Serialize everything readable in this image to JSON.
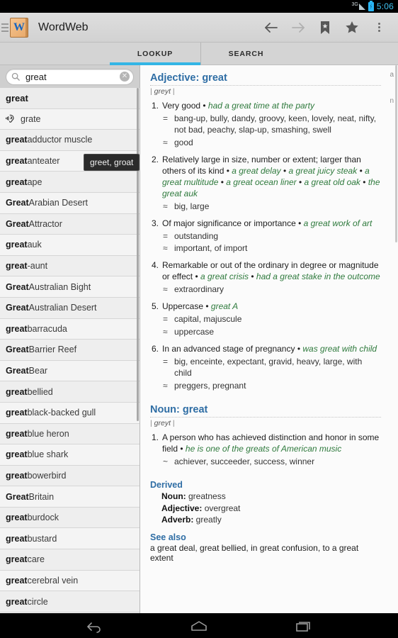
{
  "statusbar": {
    "network": "3G",
    "time": "5:06"
  },
  "actionbar": {
    "app_title": "WordWeb",
    "logo_letter": "W",
    "buttons": [
      {
        "name": "back",
        "label": "Back"
      },
      {
        "name": "forward",
        "label": "Forward"
      },
      {
        "name": "bookmark",
        "label": "Bookmarks"
      },
      {
        "name": "favourite",
        "label": "Favourite"
      },
      {
        "name": "overflow",
        "label": "More options"
      }
    ]
  },
  "tabs": [
    {
      "label": "LOOKUP",
      "active": true
    },
    {
      "label": "SEARCH",
      "active": false
    }
  ],
  "search": {
    "value": "great",
    "placeholder": "Search",
    "clear_label": "✕"
  },
  "tooltip": {
    "text": "greet, groat"
  },
  "wordlist": [
    {
      "bold": "great",
      "rest": "",
      "icon": null
    },
    {
      "bold": "",
      "rest": "grate",
      "icon": "sounds-like-icon"
    },
    {
      "bold": "great",
      "rest": " adductor muscle",
      "icon": null
    },
    {
      "bold": "great",
      "rest": " anteater",
      "icon": null
    },
    {
      "bold": "great",
      "rest": " ape",
      "icon": null
    },
    {
      "bold": "Great",
      "rest": " Arabian Desert",
      "icon": null
    },
    {
      "bold": "Great",
      "rest": " Attractor",
      "icon": null
    },
    {
      "bold": "great",
      "rest": " auk",
      "icon": null
    },
    {
      "bold": "great",
      "rest": "-aunt",
      "icon": null
    },
    {
      "bold": "Great",
      "rest": " Australian Bight",
      "icon": null
    },
    {
      "bold": "Great",
      "rest": " Australian Desert",
      "icon": null
    },
    {
      "bold": "great",
      "rest": " barracuda",
      "icon": null
    },
    {
      "bold": "Great",
      "rest": " Barrier Reef",
      "icon": null
    },
    {
      "bold": "Great",
      "rest": " Bear",
      "icon": null
    },
    {
      "bold": "great",
      "rest": " bellied",
      "icon": null
    },
    {
      "bold": "great",
      "rest": " black-backed gull",
      "icon": null
    },
    {
      "bold": "great",
      "rest": " blue heron",
      "icon": null
    },
    {
      "bold": "great",
      "rest": " blue shark",
      "icon": null
    },
    {
      "bold": "great",
      "rest": " bowerbird",
      "icon": null
    },
    {
      "bold": "Great",
      "rest": " Britain",
      "icon": null
    },
    {
      "bold": "great",
      "rest": " burdock",
      "icon": null
    },
    {
      "bold": "great",
      "rest": " bustard",
      "icon": null
    },
    {
      "bold": "great",
      "rest": " care",
      "icon": null
    },
    {
      "bold": "great",
      "rest": " cerebral vein",
      "icon": null
    },
    {
      "bold": "great",
      "rest": " circle",
      "icon": null
    }
  ],
  "pos_index": [
    "a",
    "n"
  ],
  "entry": {
    "adjective": {
      "heading": "Adjective: great",
      "pronunciation": "greyt",
      "senses": [
        {
          "num": "1.",
          "definition": "Very good",
          "examples": [
            "had a great time at the party"
          ],
          "relations": [
            {
              "mark": "=",
              "value": "bang-up, bully, dandy, groovy, keen, lovely, neat, nifty, not bad, peachy, slap-up, smashing, swell"
            },
            {
              "mark": "≈",
              "value": "good"
            }
          ]
        },
        {
          "num": "2.",
          "definition": "Relatively large in size, number or extent; larger than others of its kind",
          "examples": [
            "a great delay",
            "a great juicy steak",
            "a great multitude",
            "a great ocean liner",
            "a great old oak",
            "the great auk"
          ],
          "relations": [
            {
              "mark": "≈",
              "value": "big, large"
            }
          ]
        },
        {
          "num": "3.",
          "definition": "Of major significance or importance",
          "examples": [
            "a great work of art"
          ],
          "relations": [
            {
              "mark": "=",
              "value": "outstanding"
            },
            {
              "mark": "≈",
              "value": "important, of import"
            }
          ]
        },
        {
          "num": "4.",
          "definition": "Remarkable or out of the ordinary in degree or magnitude or effect",
          "examples": [
            "a great crisis",
            "had a great stake in the outcome"
          ],
          "relations": [
            {
              "mark": "≈",
              "value": "extraordinary"
            }
          ]
        },
        {
          "num": "5.",
          "definition": "Uppercase",
          "examples": [
            "great A"
          ],
          "relations": [
            {
              "mark": "=",
              "value": "capital, majuscule"
            },
            {
              "mark": "≈",
              "value": "uppercase"
            }
          ]
        },
        {
          "num": "6.",
          "definition": "In an advanced stage of pregnancy",
          "examples": [
            "was great with child"
          ],
          "relations": [
            {
              "mark": "=",
              "value": "big, enceinte, expectant, gravid, heavy, large, with child"
            },
            {
              "mark": "≈",
              "value": "preggers, pregnant"
            }
          ]
        }
      ]
    },
    "noun": {
      "heading": "Noun: great",
      "pronunciation": "greyt",
      "senses": [
        {
          "num": "1.",
          "definition": "A person who has achieved distinction and honor in some field",
          "examples": [
            "he is one of the greats of American music"
          ],
          "relations": [
            {
              "mark": "~",
              "value": "achiever, succeeder, success, winner"
            }
          ]
        }
      ]
    },
    "derived": {
      "heading": "Derived",
      "rows": [
        {
          "pos": "Noun:",
          "value": " greatness"
        },
        {
          "pos": "Adjective:",
          "value": " overgreat"
        },
        {
          "pos": "Adverb:",
          "value": " greatly"
        }
      ]
    },
    "see_also": {
      "heading": "See also",
      "text": "a great deal, great bellied, in great confusion, to a great extent"
    }
  },
  "navbar": [
    {
      "name": "android-back",
      "label": "Back"
    },
    {
      "name": "android-home",
      "label": "Home"
    },
    {
      "name": "android-recents",
      "label": "Recent apps"
    }
  ],
  "colors": {
    "accent": "#33b5e5",
    "heading": "#2e6da4",
    "example": "#2f7a3d",
    "statusbar": "#000000"
  }
}
